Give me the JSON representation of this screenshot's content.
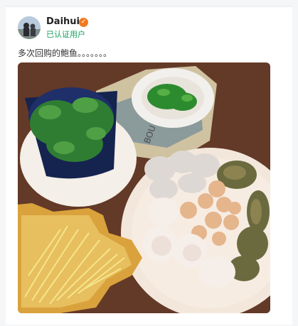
{
  "post": {
    "author": "Daihui",
    "verified_badge_icon": "verified-badge-icon",
    "verification_text": "已认证用户",
    "text": "多次回购的鲍鱼。。。。。。。",
    "image_alt": "food-prep-photo"
  },
  "colors": {
    "verified_green": "#16a05d",
    "badge_orange": "#f17a1f"
  }
}
